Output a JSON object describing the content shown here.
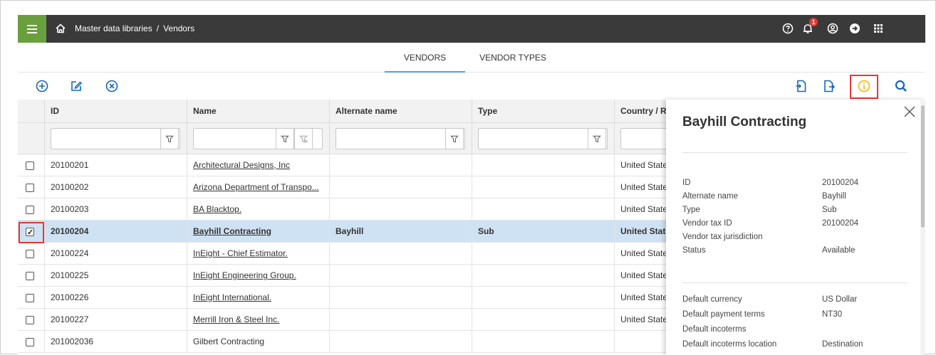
{
  "breadcrumb": {
    "section": "Master data libraries",
    "separator": "/",
    "page": "Vendors"
  },
  "notifications": {
    "count": "1"
  },
  "tabs": [
    {
      "label": "VENDORS",
      "active": true
    },
    {
      "label": "VENDOR TYPES",
      "active": false
    }
  ],
  "table": {
    "columns": [
      "ID",
      "Name",
      "Alternate name",
      "Type",
      "Country / Re"
    ],
    "rows": [
      {
        "id": "20100201",
        "name": "Architectural Designs, Inc",
        "alt": "",
        "type": "",
        "country": "United State",
        "checked": false,
        "selected": false
      },
      {
        "id": "20100202",
        "name": "Arizona Department of Transpo...",
        "alt": "",
        "type": "",
        "country": "United State",
        "checked": false,
        "selected": false
      },
      {
        "id": "20100203",
        "name": "BA Blacktop.",
        "alt": "",
        "type": "",
        "country": "United State",
        "checked": false,
        "selected": false
      },
      {
        "id": "20100204",
        "name": "Bayhill Contracting",
        "alt": "Bayhill",
        "type": "Sub",
        "country": "United State",
        "checked": true,
        "selected": true
      },
      {
        "id": "20100224",
        "name": "InEight - Chief Estimator.",
        "alt": "",
        "type": "",
        "country": "United State",
        "checked": false,
        "selected": false
      },
      {
        "id": "20100225",
        "name": "InEight Engineering Group.",
        "alt": "",
        "type": "",
        "country": "United State",
        "checked": false,
        "selected": false
      },
      {
        "id": "20100226",
        "name": "InEight International.",
        "alt": "",
        "type": "",
        "country": "United State",
        "checked": false,
        "selected": false
      },
      {
        "id": "20100227",
        "name": "Merrill Iron & Steel Inc.",
        "alt": "",
        "type": "",
        "country": "United State",
        "checked": false,
        "selected": false
      },
      {
        "id": "201002036",
        "name": "Gilbert Contracting",
        "alt": "",
        "type": "",
        "country": "",
        "checked": false,
        "selected": false
      }
    ]
  },
  "panel": {
    "title": "Bayhill Contracting",
    "fields_a": [
      {
        "label": "ID",
        "value": "20100204"
      },
      {
        "label": "Alternate name",
        "value": "Bayhill"
      },
      {
        "label": "Type",
        "value": "Sub"
      },
      {
        "label": "Vendor tax ID",
        "value": "20100204"
      },
      {
        "label": "Vendor tax jurisdiction",
        "value": ""
      },
      {
        "label": "Status",
        "value": "Available"
      }
    ],
    "fields_b": [
      {
        "label": "Default currency",
        "value": "US Dollar"
      },
      {
        "label": "Default payment terms",
        "value": "NT30"
      },
      {
        "label": "Default incoterms",
        "value": ""
      },
      {
        "label": "Default incoterms location",
        "value": "Destination"
      }
    ]
  },
  "colors": {
    "menu": "#6a9f3d",
    "topbar": "#3a3a3a",
    "accent": "#1565c0",
    "selected_row": "#cfe2f3",
    "highlight": "#e53935",
    "info_icon": "#f5b800"
  },
  "icons": [
    "menu-icon",
    "home-icon",
    "help-icon",
    "bell-icon",
    "account-icon",
    "signout-icon",
    "apps-grid-icon",
    "add-icon",
    "edit-icon",
    "cancel-icon",
    "import-icon",
    "export-icon",
    "info-icon",
    "search-icon",
    "filter-icon",
    "clear-filter-icon",
    "close-icon"
  ]
}
